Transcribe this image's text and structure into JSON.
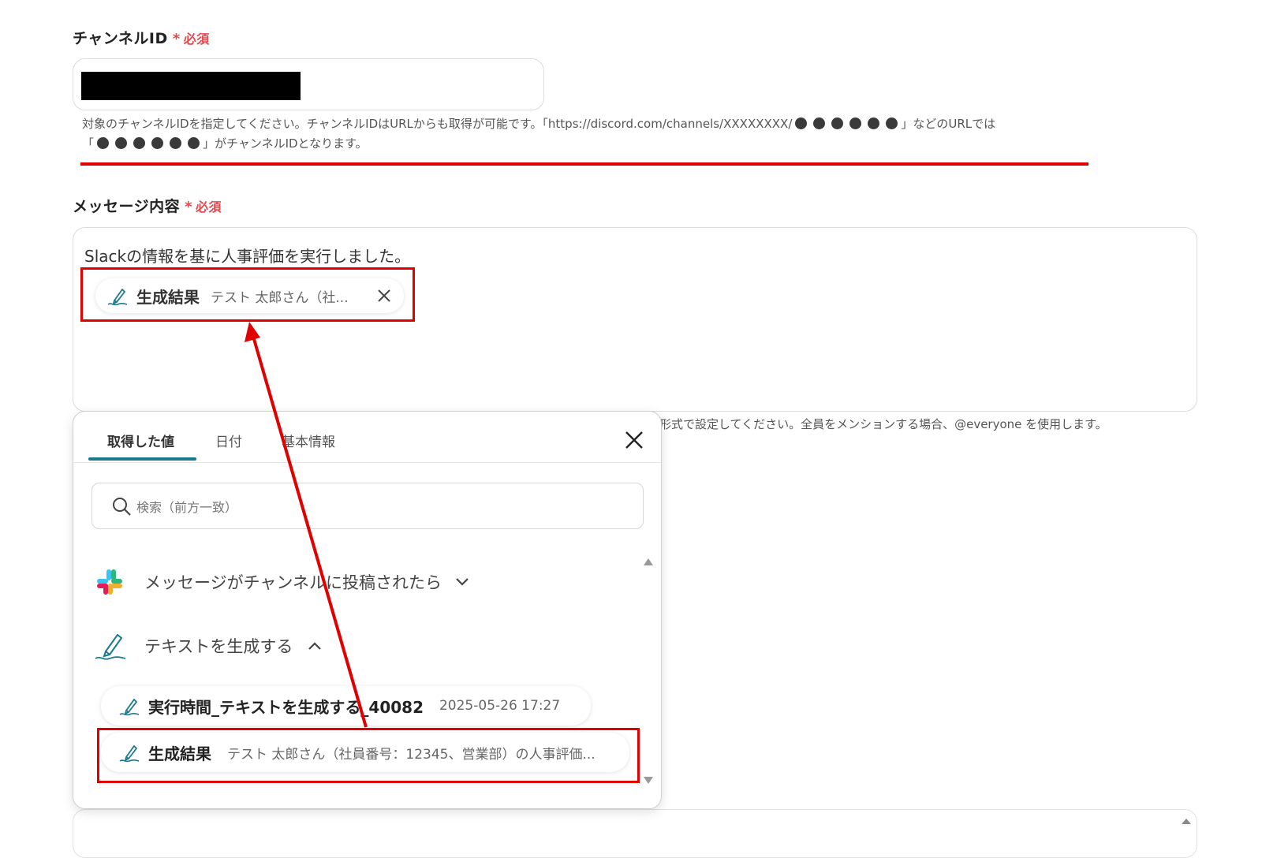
{
  "channel": {
    "label": "チャンネルID",
    "required_star": "*",
    "required_text": "必須",
    "help_line1_a": "対象のチャンネルIDを指定してください。チャンネルIDはURLからも取得が可能です。「https://discord.com/channels/XXXXXXXX/",
    "help_line1_b": "」などのURLでは",
    "help_line2_a": "「",
    "help_line2_b": "」がチャンネルIDとなります。"
  },
  "message": {
    "label": "メッセージ内容",
    "required_star": "*",
    "required_text": "必須",
    "text": "Slackの情報を基に人事評価を実行しました。",
    "chip_title": "生成結果",
    "chip_value": "テスト 太郎さん（社...",
    "help_tail": "形式で設定してください。全員をメンションする場合、@everyone を使用します。"
  },
  "panel": {
    "tabs": [
      {
        "label": "取得した値"
      },
      {
        "label": "日付"
      },
      {
        "label": "基本情報"
      }
    ],
    "search_placeholder": "検索（前方一致）",
    "groups": [
      {
        "title": "メッセージがチャンネルに投稿されたら"
      },
      {
        "title": "テキストを生成する"
      }
    ],
    "items": [
      {
        "title": "実行時間_テキストを生成する_40082",
        "value": "2025-05-26 17:27"
      },
      {
        "title": "生成結果",
        "value": "テスト 太郎さん（社員番号：12345、営業部）の人事評価..."
      }
    ]
  },
  "colors": {
    "required": "#e5484d",
    "highlight": "#e00000",
    "tab_underline": "#1a7a8c"
  }
}
